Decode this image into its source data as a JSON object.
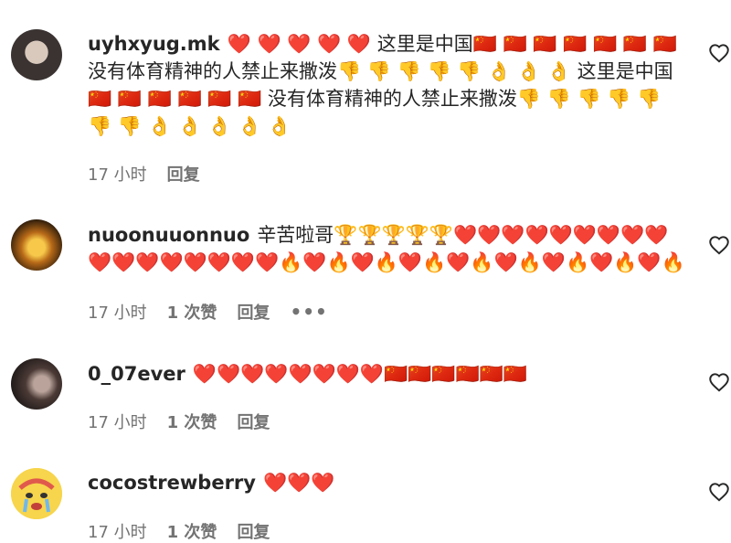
{
  "comments": [
    {
      "username": "uyhxyug.mk",
      "text": "❤️ ❤️ ❤️ ❤️ ❤️ 这里是中国🇨🇳 🇨🇳 🇨🇳 🇨🇳 🇨🇳 🇨🇳 🇨🇳 没有体育精神的人禁止来撒泼👎 👎 👎 👎 👎 👌 👌 👌 这里是中国🇨🇳 🇨🇳 🇨🇳 🇨🇳 🇨🇳 🇨🇳 没有体育精神的人禁止来撒泼👎 👎 👎 👎 👎 👎 👎 👌 👌 👌 👌 👌",
      "time": "17 小时",
      "likes": "",
      "reply": "回复",
      "more": ""
    },
    {
      "username": "nuoonuuonnuo",
      "text": "辛苦啦哥🏆🏆🏆🏆🏆❤️❤️❤️❤️❤️❤️❤️❤️❤️❤️❤️❤️❤️❤️❤️❤️❤️🔥❤️🔥❤️🔥❤️🔥❤️🔥❤️🔥❤️🔥❤️🔥❤️🔥",
      "time": "17 小时",
      "likes": "1 次赞",
      "reply": "回复",
      "more": "•••"
    },
    {
      "username": "0_07ever",
      "text": "❤️❤️❤️❤️❤️❤️❤️❤️🇨🇳🇨🇳🇨🇳🇨🇳🇨🇳🇨🇳",
      "time": "17 小时",
      "likes": "1 次赞",
      "reply": "回复",
      "more": ""
    },
    {
      "username": "cocostrewberry",
      "text": "❤️❤️❤️",
      "time": "17 小时",
      "likes": "1 次赞",
      "reply": "回复",
      "more": ""
    }
  ]
}
